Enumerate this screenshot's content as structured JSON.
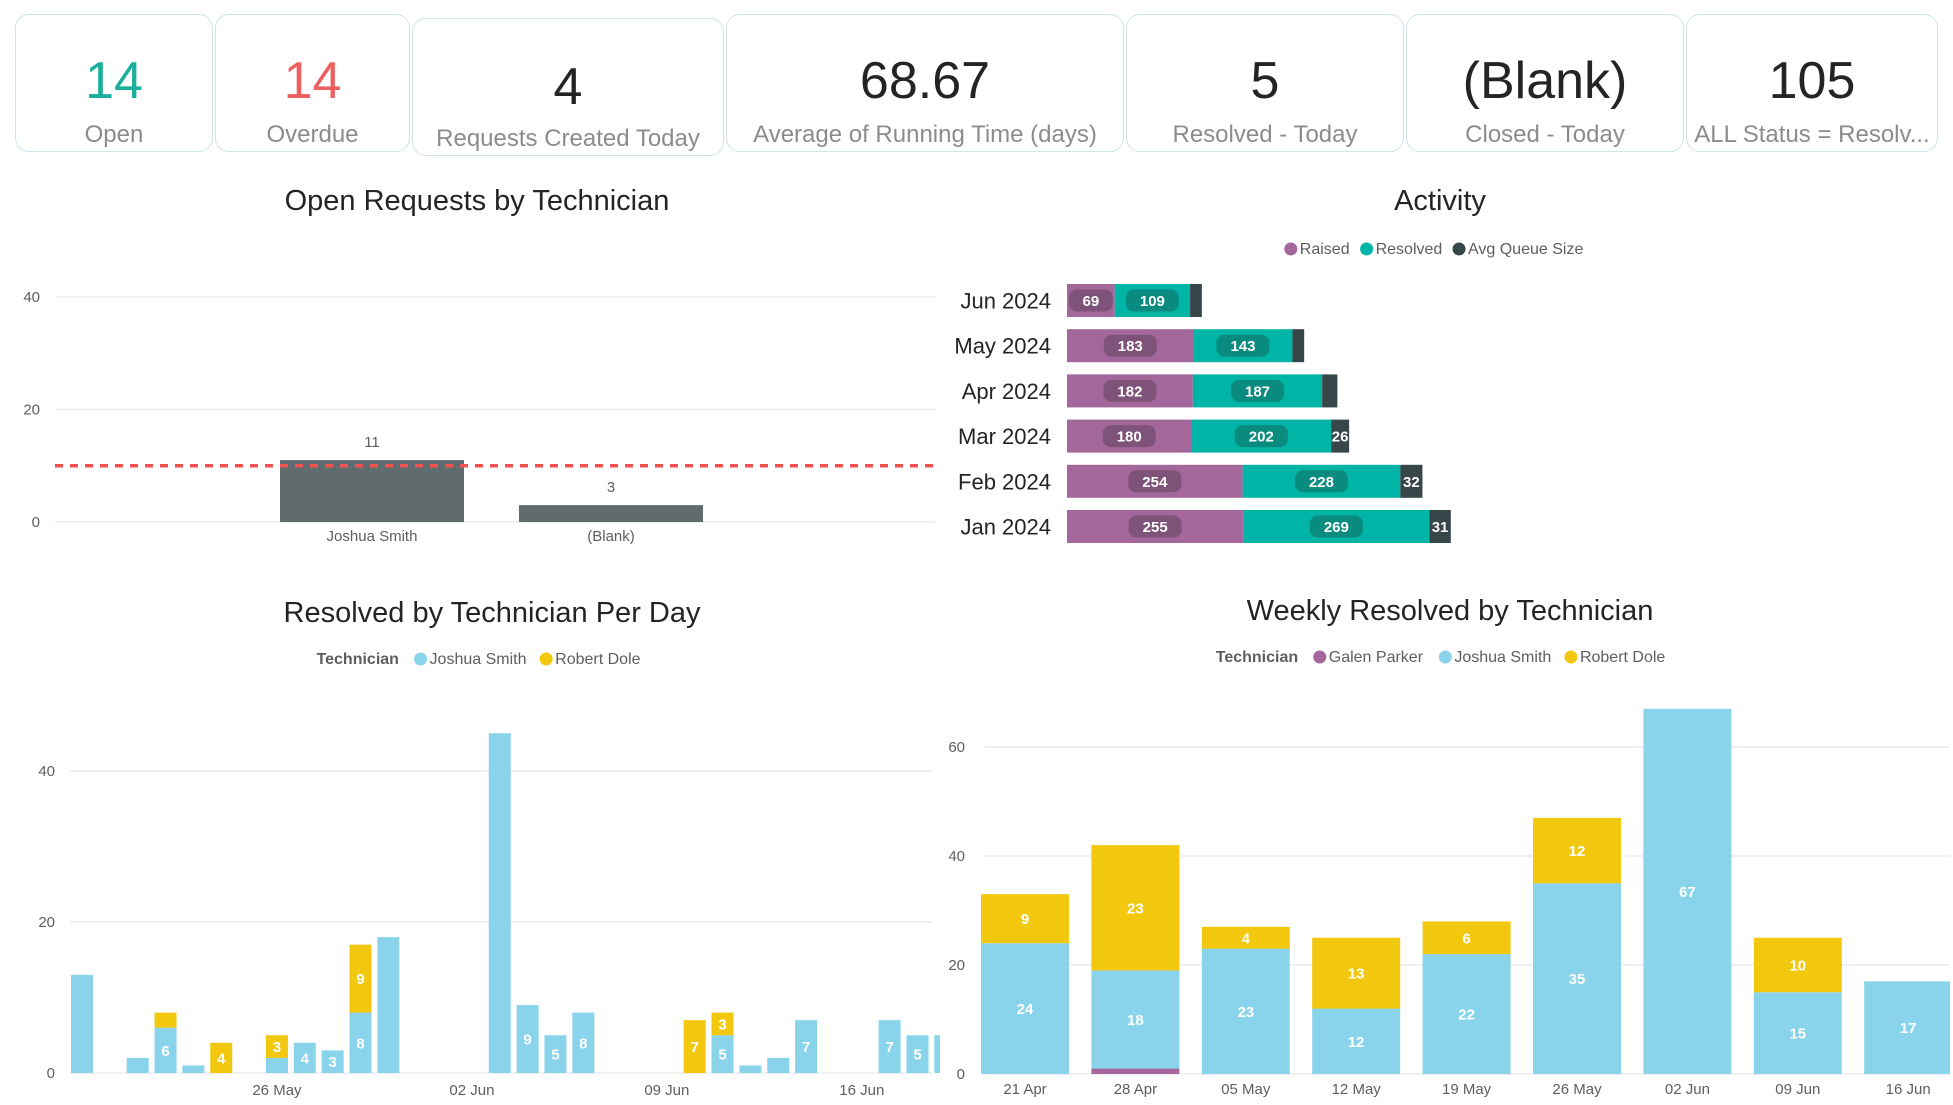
{
  "kpis": [
    {
      "value": "14",
      "label": "Open",
      "color": "#1aaf9c"
    },
    {
      "value": "14",
      "label": "Overdue",
      "color": "#ee6060"
    },
    {
      "value": "4",
      "label": "Requests Created Today",
      "color": "#252423"
    },
    {
      "value": "68.67",
      "label": "Average of Running Time (days)",
      "color": "#252423"
    },
    {
      "value": "5",
      "label": "Resolved - Today",
      "color": "#252423"
    },
    {
      "value": "(Blank)",
      "label": "Closed - Today",
      "color": "#252423"
    },
    {
      "value": "105",
      "label": "ALL Status = Resolv...",
      "color": "#252423"
    }
  ],
  "chart_data": [
    {
      "type": "bar",
      "title": "Open Requests by Technician",
      "categories": [
        "Joshua Smith",
        "(Blank)"
      ],
      "values": [
        11,
        3
      ],
      "ylim": [
        0,
        40
      ],
      "yticks": [
        0,
        20,
        40
      ],
      "reference_line": 10,
      "colors": {
        "bar": "#5f6b6d",
        "reference": "#ef5350"
      },
      "grid": true
    },
    {
      "type": "bar",
      "orientation": "horizontal",
      "stacked": true,
      "title": "Activity",
      "categories": [
        "Jun 2024",
        "May 2024",
        "Apr 2024",
        "Mar 2024",
        "Feb 2024",
        "Jan 2024"
      ],
      "legend_position": "top-center",
      "series": [
        {
          "name": "Raised",
          "color": "#a4679b",
          "values": [
            69,
            183,
            182,
            180,
            254,
            255
          ]
        },
        {
          "name": "Resolved",
          "color": "#00b5a5",
          "values": [
            109,
            143,
            187,
            202,
            228,
            269
          ]
        },
        {
          "name": "Avg Queue Size",
          "color": "#374649",
          "values": [
            17,
            17,
            22,
            26,
            32,
            31
          ]
        }
      ],
      "labels_shown": [
        [
          true,
          true,
          false
        ],
        [
          true,
          true,
          false
        ],
        [
          true,
          true,
          false
        ],
        [
          true,
          true,
          true
        ],
        [
          true,
          true,
          true
        ],
        [
          true,
          true,
          true
        ]
      ]
    },
    {
      "type": "bar",
      "stacked": true,
      "title": "Resolved by Technician Per Day",
      "legend_title": "Technician",
      "legend_position": "top-center",
      "x_range": [
        "2024-05-19",
        "2024-06-18"
      ],
      "x_ticks": [
        "2024-05-26",
        "2024-06-02",
        "2024-06-09",
        "2024-06-16"
      ],
      "x_tick_labels": [
        "26 May",
        "02 Jun",
        "09 Jun",
        "16 Jun"
      ],
      "ylim": [
        0,
        45
      ],
      "yticks": [
        0,
        20,
        40
      ],
      "grid": true,
      "series": [
        {
          "name": "Joshua Smith",
          "color": "#8ad4eb"
        },
        {
          "name": "Robert Dole",
          "color": "#f2c80f"
        }
      ],
      "points": [
        {
          "date": "2024-05-19",
          "Joshua Smith": 13,
          "Robert Dole": 0
        },
        {
          "date": "2024-05-21",
          "Joshua Smith": 2,
          "Robert Dole": 0
        },
        {
          "date": "2024-05-22",
          "Joshua Smith": 6,
          "Robert Dole": 2
        },
        {
          "date": "2024-05-23",
          "Joshua Smith": 1,
          "Robert Dole": 0
        },
        {
          "date": "2024-05-24",
          "Joshua Smith": 0,
          "Robert Dole": 4
        },
        {
          "date": "2024-05-26",
          "Joshua Smith": 2,
          "Robert Dole": 3
        },
        {
          "date": "2024-05-27",
          "Joshua Smith": 4,
          "Robert Dole": 0
        },
        {
          "date": "2024-05-28",
          "Joshua Smith": 3,
          "Robert Dole": 0
        },
        {
          "date": "2024-05-29",
          "Joshua Smith": 8,
          "Robert Dole": 9
        },
        {
          "date": "2024-05-30",
          "Joshua Smith": 18,
          "Robert Dole": 0
        },
        {
          "date": "2024-06-03",
          "Joshua Smith": 45,
          "Robert Dole": 0
        },
        {
          "date": "2024-06-04",
          "Joshua Smith": 9,
          "Robert Dole": 0
        },
        {
          "date": "2024-06-05",
          "Joshua Smith": 5,
          "Robert Dole": 0
        },
        {
          "date": "2024-06-06",
          "Joshua Smith": 8,
          "Robert Dole": 0
        },
        {
          "date": "2024-06-10",
          "Joshua Smith": 0,
          "Robert Dole": 7
        },
        {
          "date": "2024-06-11",
          "Joshua Smith": 5,
          "Robert Dole": 3
        },
        {
          "date": "2024-06-12",
          "Joshua Smith": 1,
          "Robert Dole": 0
        },
        {
          "date": "2024-06-13",
          "Joshua Smith": 2,
          "Robert Dole": 0
        },
        {
          "date": "2024-06-14",
          "Joshua Smith": 7,
          "Robert Dole": 0
        },
        {
          "date": "2024-06-17",
          "Joshua Smith": 7,
          "Robert Dole": 0
        },
        {
          "date": "2024-06-18",
          "Joshua Smith": 5,
          "Robert Dole": 0
        },
        {
          "date": "2024-06-19",
          "Joshua Smith": 5,
          "Robert Dole": 0
        }
      ]
    },
    {
      "type": "bar",
      "stacked": true,
      "title": "Weekly Resolved by Technician",
      "legend_title": "Technician",
      "legend_position": "top-center",
      "categories": [
        "21 Apr",
        "28 Apr",
        "05 May",
        "12 May",
        "19 May",
        "26 May",
        "02 Jun",
        "09 Jun",
        "16 Jun"
      ],
      "ylim": [
        0,
        67
      ],
      "yticks": [
        0,
        20,
        40,
        60
      ],
      "grid": true,
      "series": [
        {
          "name": "Galen Parker",
          "color": "#a4679b",
          "values": [
            0,
            1,
            0,
            0,
            0,
            0,
            0,
            0,
            0
          ]
        },
        {
          "name": "Joshua Smith",
          "color": "#8ad4eb",
          "values": [
            24,
            18,
            23,
            12,
            22,
            35,
            67,
            15,
            17
          ]
        },
        {
          "name": "Robert Dole",
          "color": "#f2c80f",
          "values": [
            9,
            23,
            4,
            13,
            6,
            12,
            0,
            10,
            0
          ]
        }
      ]
    }
  ]
}
